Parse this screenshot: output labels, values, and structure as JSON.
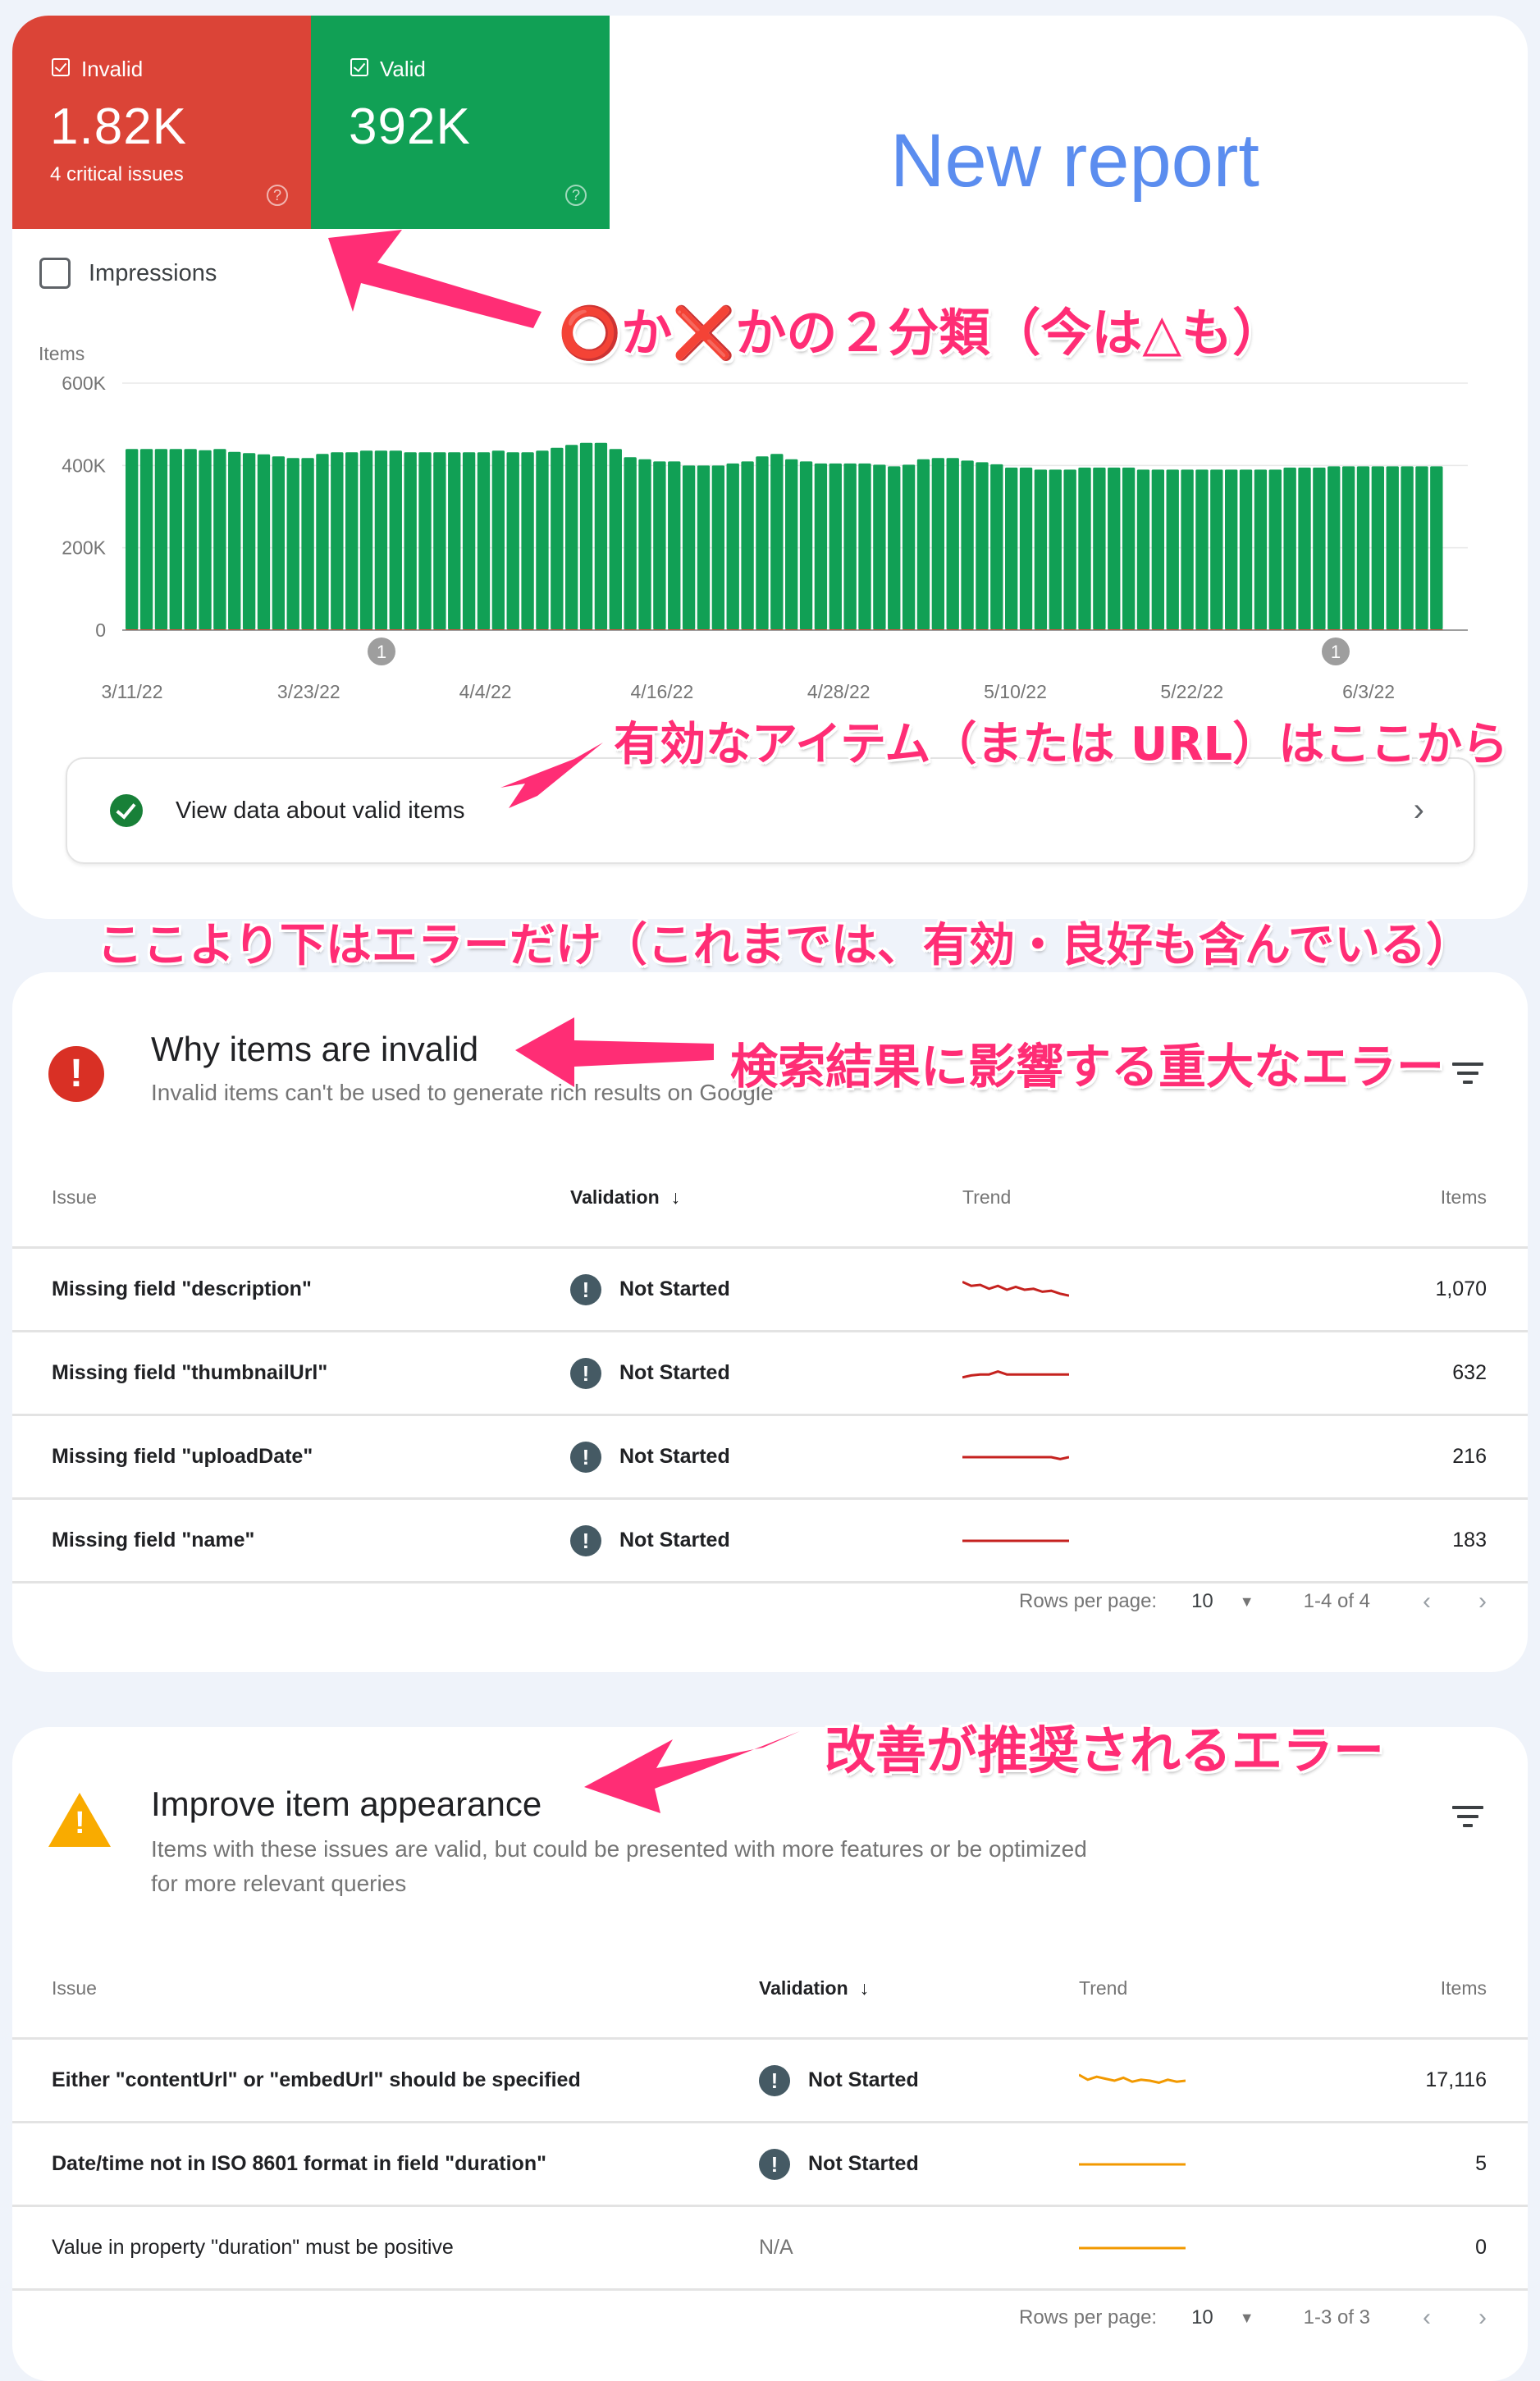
{
  "summary": {
    "invalid": {
      "label": "Invalid",
      "value": "1.82K",
      "sub": "4 critical issues",
      "color": "#db4437"
    },
    "valid": {
      "label": "Valid",
      "value": "392K",
      "color": "#11a055"
    },
    "help_glyph": "?",
    "new_report": "New report",
    "impressions_label": "Impressions",
    "view_valid_label": "View data about valid items",
    "chevron_glyph": "›"
  },
  "chart_data": {
    "type": "bar",
    "title": "",
    "ylabel": "Items",
    "xlabel": "",
    "ylim": [
      0,
      600000
    ],
    "yticks": [
      "0",
      "200K",
      "400K",
      "600K"
    ],
    "xtick_labels": [
      "3/11/22",
      "3/23/22",
      "4/4/22",
      "4/16/22",
      "4/28/22",
      "5/10/22",
      "5/22/22",
      "6/3/22"
    ],
    "grid": true,
    "annotations": [
      {
        "label": "1",
        "near": "3/27/22"
      },
      {
        "label": "1",
        "near": "6/4/22"
      }
    ],
    "series": [
      {
        "name": "Valid",
        "color": "#11a055",
        "values": [
          440000,
          440000,
          440000,
          440000,
          440000,
          437000,
          440000,
          433000,
          430000,
          427000,
          422000,
          418000,
          418000,
          428000,
          432000,
          432000,
          436000,
          436000,
          436000,
          432000,
          432000,
          432000,
          432000,
          432000,
          432000,
          436000,
          432000,
          432000,
          436000,
          443000,
          450000,
          455000,
          455000,
          440000,
          420000,
          415000,
          410000,
          410000,
          400000,
          400000,
          400000,
          405000,
          410000,
          422000,
          428000,
          415000,
          410000,
          405000,
          405000,
          405000,
          405000,
          402000,
          398000,
          402000,
          415000,
          418000,
          418000,
          412000,
          408000,
          403000,
          395000,
          395000,
          390000,
          390000,
          390000,
          395000,
          395000,
          395000,
          395000,
          390000,
          390000,
          390000,
          390000,
          390000,
          390000,
          390000,
          390000,
          390000,
          390000,
          395000,
          395000,
          395000,
          398000,
          398000,
          398000,
          398000,
          398000,
          398000,
          398000,
          398000
        ]
      },
      {
        "name": "Invalid",
        "color": "#db4437",
        "values": [
          1800,
          1800,
          1800,
          1800,
          1800,
          1800,
          1800,
          1800,
          1800,
          1800,
          1800,
          1800,
          1800,
          1800,
          1800,
          1800,
          1800,
          1800,
          1800,
          1800,
          1800,
          1800,
          1800,
          1800,
          1800,
          1800,
          1800,
          1800,
          1800,
          1800,
          1800,
          1800,
          1800,
          1800,
          1800,
          1800,
          1800,
          1800,
          1800,
          1800,
          1800,
          1800,
          1800,
          1800,
          1800,
          1800,
          1800,
          1800,
          1800,
          1800,
          1800,
          1800,
          1800,
          1800,
          1800,
          1800,
          1800,
          1800,
          1800,
          1800,
          1800,
          1800,
          1800,
          1800,
          1800,
          1800,
          1800,
          1800,
          1800,
          1800,
          1800,
          1800,
          1800,
          1800,
          1800,
          1800,
          1800,
          1800,
          1800,
          1800,
          1800,
          1800,
          1800,
          1800,
          1800,
          1800,
          1800,
          1800,
          1800,
          1820
        ]
      }
    ]
  },
  "invalid_section": {
    "title": "Why items are invalid",
    "description": "Invalid items can't be used to generate rich results on Google",
    "columns": {
      "issue": "Issue",
      "validation": "Validation",
      "trend": "Trend",
      "items": "Items"
    },
    "sort_glyph": "↓",
    "trend_color": "#c5221f",
    "rows": [
      {
        "issue": "Missing field \"description\"",
        "validation": "Not Started",
        "items": "1,070",
        "trend": [
          0.9,
          0.7,
          0.75,
          0.55,
          0.7,
          0.5,
          0.65,
          0.5,
          0.55,
          0.4,
          0.45,
          0.3,
          0.2
        ]
      },
      {
        "issue": "Missing field \"thumbnailUrl\"",
        "validation": "Not Started",
        "items": "632",
        "trend": [
          0.3,
          0.4,
          0.45,
          0.45,
          0.6,
          0.45,
          0.45,
          0.45,
          0.45,
          0.45,
          0.45,
          0.45,
          0.45
        ]
      },
      {
        "issue": "Missing field \"uploadDate\"",
        "validation": "Not Started",
        "items": "216",
        "trend": [
          0.5,
          0.5,
          0.5,
          0.5,
          0.5,
          0.5,
          0.5,
          0.5,
          0.5,
          0.5,
          0.5,
          0.4,
          0.5
        ]
      },
      {
        "issue": "Missing field \"name\"",
        "validation": "Not Started",
        "items": "183",
        "trend": [
          0.5,
          0.5,
          0.5,
          0.5,
          0.5,
          0.5,
          0.5,
          0.5,
          0.5,
          0.5,
          0.5,
          0.5,
          0.5
        ]
      }
    ],
    "pager": {
      "rows_per_page_label": "Rows per page:",
      "rows_per_page": "10",
      "range": "1-4 of 4"
    }
  },
  "improve_section": {
    "title": "Improve item appearance",
    "description": "Items with these issues are valid, but could be presented with more features or be optimized for more relevant queries",
    "columns": {
      "issue": "Issue",
      "validation": "Validation",
      "trend": "Trend",
      "items": "Items"
    },
    "sort_glyph": "↓",
    "trend_color": "#f29900",
    "rows": [
      {
        "issue": "Either \"contentUrl\" or \"embedUrl\" should be specified",
        "validation": "Not Started",
        "items": "17,116",
        "trend": [
          0.8,
          0.55,
          0.7,
          0.6,
          0.5,
          0.65,
          0.45,
          0.55,
          0.5,
          0.4,
          0.55,
          0.45,
          0.5
        ]
      },
      {
        "issue": "Date/time not in ISO 8601 format in field \"duration\"",
        "validation": "Not Started",
        "items": "5",
        "trend": [
          0.5,
          0.5,
          0.5,
          0.5,
          0.5,
          0.5,
          0.5,
          0.5,
          0.5,
          0.5,
          0.5,
          0.5,
          0.5
        ]
      },
      {
        "issue": "Value in property \"duration\" must be positive",
        "validation": "N/A",
        "items": "0",
        "trend": [
          0.5,
          0.5,
          0.5,
          0.5,
          0.5,
          0.5,
          0.5,
          0.5,
          0.5,
          0.5,
          0.5,
          0.5,
          0.5
        ]
      }
    ],
    "pager": {
      "rows_per_page_label": "Rows per page:",
      "rows_per_page": "10",
      "range": "1-3 of 3"
    }
  },
  "annotations": {
    "two_categories": "⭕か❌かの２分類（今は△も）",
    "valid_here": "有効なアイテム（または URL）はここから",
    "errors_below": "ここより下はエラーだけ（これまでは、有効・良好も含んでいる）",
    "critical_errors": "検索結果に影響する重大なエラー",
    "recommended_errors": "改善が推奨されるエラー",
    "color": "#ff2d75"
  }
}
